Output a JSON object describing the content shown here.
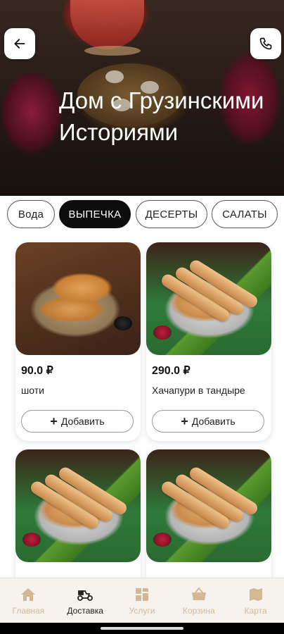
{
  "header": {
    "title": "Дом с Грузинскими Историями",
    "back_icon": "arrow-left-icon",
    "call_icon": "phone-icon"
  },
  "categories": [
    {
      "label": "Вода",
      "active": false
    },
    {
      "label": "ВЫПЕЧКА",
      "active": true
    },
    {
      "label": "ДЕСЕРТЫ",
      "active": false
    },
    {
      "label": "САЛАТЫ",
      "active": false
    }
  ],
  "products": [
    {
      "price": "90.0 ₽",
      "name": "шоти",
      "add_label": "Добавить"
    },
    {
      "price": "290.0 ₽",
      "name": "Хачапури в тандыре",
      "add_label": "Добавить"
    },
    {
      "price": "",
      "name": "",
      "add_label": ""
    },
    {
      "price": "",
      "name": "",
      "add_label": ""
    }
  ],
  "bottom_nav": [
    {
      "label": "Главная",
      "icon": "home-icon",
      "active": false
    },
    {
      "label": "Доставка",
      "icon": "scooter-icon",
      "active": true
    },
    {
      "label": "Услуги",
      "icon": "grid-icon",
      "active": false
    },
    {
      "label": "Корзина",
      "icon": "basket-icon",
      "active": false
    },
    {
      "label": "Карта",
      "icon": "map-icon",
      "active": false
    }
  ],
  "colors": {
    "accent": "#0d0d0d",
    "nav_inactive": "#d4b896",
    "nav_active": "#222222"
  }
}
